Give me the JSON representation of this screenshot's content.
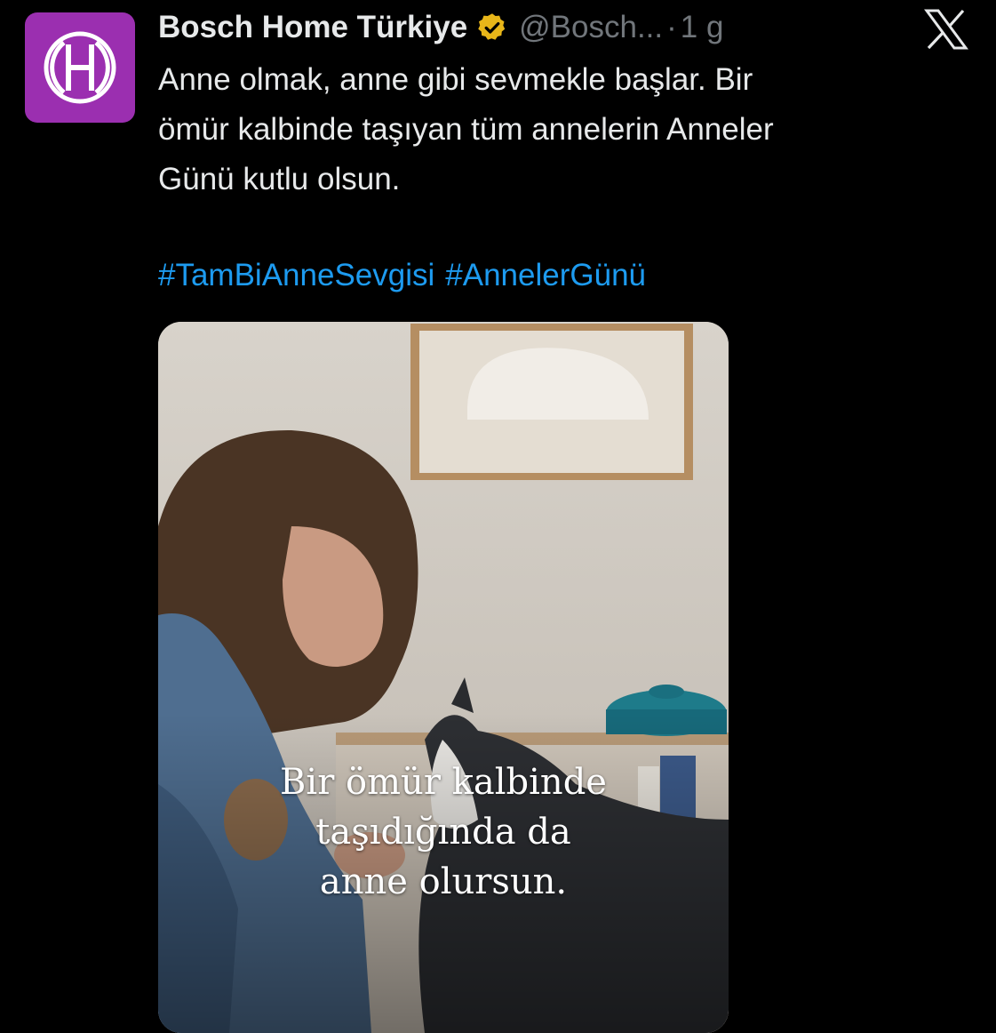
{
  "author": {
    "display_name": "Bosch Home Türkiye",
    "handle": "@Bosch...",
    "separator": "·",
    "time": "1 g",
    "avatar_color": "#9b2fb0",
    "verified_color": "#e8b619"
  },
  "tweet": {
    "text_lines": [
      "Anne olmak, anne gibi sevmekle başlar. Bir",
      "ömür kalbinde taşıyan tüm annelerin Anneler",
      "Günü kutlu olsun."
    ],
    "hashtags": [
      "#TamBiAnneSevgisi",
      "#AnnelerGünü"
    ],
    "hashtag_color": "#1d9bf0"
  },
  "media": {
    "caption_lines": [
      "Bir ömür kalbinde",
      "taşıdığında da",
      "anne olursun."
    ]
  },
  "icons": {
    "brand": "bosch-logo-icon",
    "verified": "verified-badge-icon",
    "platform": "x-logo-icon"
  }
}
